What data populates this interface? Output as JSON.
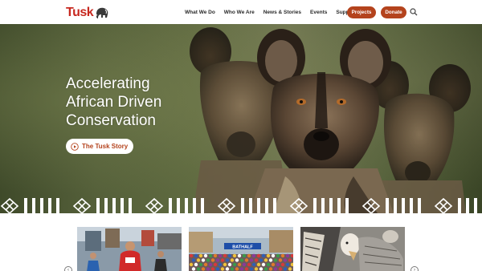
{
  "brand": {
    "name": "Tusk",
    "accent": "#b4431d",
    "logo_red": "#c7281f"
  },
  "nav": {
    "items": [
      {
        "label": "What We Do"
      },
      {
        "label": "Who We Are"
      },
      {
        "label": "News & Stories"
      },
      {
        "label": "Events"
      },
      {
        "label": "Support Us"
      }
    ],
    "projects_label": "Projects",
    "donate_label": "Donate",
    "search_icon": "search-icon"
  },
  "hero": {
    "title_line1": "Accelerating",
    "title_line2": "African Driven",
    "title_line3": "Conservation",
    "cta_label": "The Tusk Story",
    "cta_icon": "play-circle-icon"
  },
  "carousel": {
    "prev_icon": "chevron-left-icon",
    "next_icon": "chevron-right-icon",
    "cards": [
      {
        "caption": ""
      },
      {
        "banner": "BATHALF"
      },
      {
        "caption": ""
      }
    ]
  }
}
